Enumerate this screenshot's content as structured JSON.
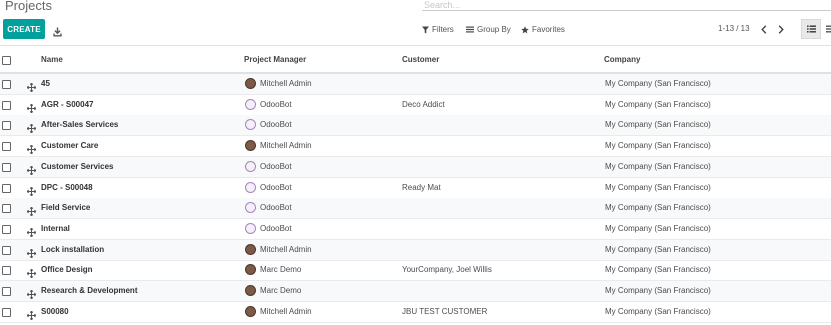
{
  "header": {
    "title": "Projects",
    "search_placeholder": "Search..."
  },
  "toolbar": {
    "create_label": "CREATE",
    "download_icon": "download-icon",
    "filters_label": "Filters",
    "group_by_label": "Group By",
    "favorites_label": "Favorites"
  },
  "pager": {
    "range": "1-13 / 13"
  },
  "columns": {
    "name": "Name",
    "project_manager": "Project Manager",
    "customer": "Customer",
    "company": "Company"
  },
  "rows": [
    {
      "name": "45",
      "manager": "Mitchell Admin",
      "avatar": "photo",
      "customer": "",
      "company": "My Company (San Francisco)"
    },
    {
      "name": "AGR - S00047",
      "manager": "OdooBot",
      "avatar": "bot",
      "customer": "Deco Addict",
      "company": "My Company (San Francisco)"
    },
    {
      "name": "After-Sales Services",
      "manager": "OdooBot",
      "avatar": "bot",
      "customer": "",
      "company": "My Company (San Francisco)"
    },
    {
      "name": "Customer Care",
      "manager": "Mitchell Admin",
      "avatar": "photo",
      "customer": "",
      "company": "My Company (San Francisco)"
    },
    {
      "name": "Customer Services",
      "manager": "OdooBot",
      "avatar": "bot",
      "customer": "",
      "company": "My Company (San Francisco)"
    },
    {
      "name": "DPC - S00048",
      "manager": "OdooBot",
      "avatar": "bot",
      "customer": "Ready Mat",
      "company": "My Company (San Francisco)"
    },
    {
      "name": "Field Service",
      "manager": "OdooBot",
      "avatar": "bot",
      "customer": "",
      "company": "My Company (San Francisco)"
    },
    {
      "name": "Internal",
      "manager": "OdooBot",
      "avatar": "bot",
      "customer": "",
      "company": "My Company (San Francisco)"
    },
    {
      "name": "Lock installation",
      "manager": "Mitchell Admin",
      "avatar": "photo",
      "customer": "",
      "company": "My Company (San Francisco)"
    },
    {
      "name": "Office Design",
      "manager": "Marc Demo",
      "avatar": "photo",
      "customer": "YourCompany, Joel Willis",
      "company": "My Company (San Francisco)"
    },
    {
      "name": "Research & Development",
      "manager": "Marc Demo",
      "avatar": "photo",
      "customer": "",
      "company": "My Company (San Francisco)"
    },
    {
      "name": "S00080",
      "manager": "Mitchell Admin",
      "avatar": "photo",
      "customer": "JBU TEST CUSTOMER",
      "company": "My Company (San Francisco)"
    }
  ],
  "colors": {
    "primary": "#00a09d",
    "bot_avatar_border": "#a983c2"
  }
}
